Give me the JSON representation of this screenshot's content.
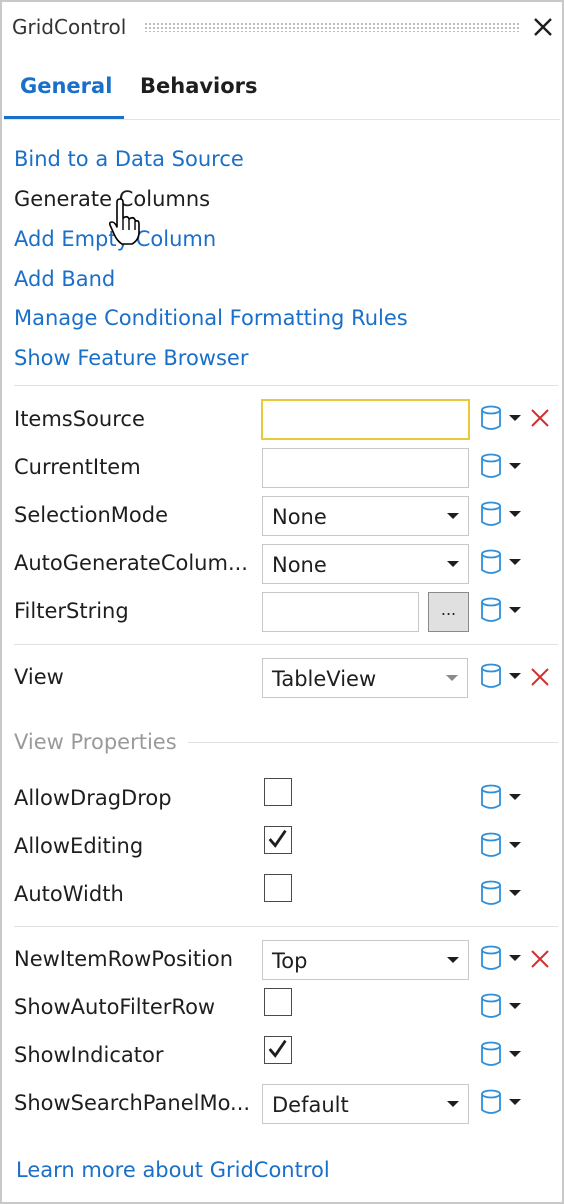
{
  "window": {
    "title": "GridControl",
    "close_icon": "close-icon"
  },
  "tabs": [
    {
      "label": "General",
      "selected": true
    },
    {
      "label": "Behaviors",
      "selected": false
    }
  ],
  "actions": [
    "Bind to a Data Source",
    "Generate Columns",
    "Add Empty Column",
    "Add Band",
    "Manage Conditional Formatting Rules",
    "Show Feature Browser"
  ],
  "properties": {
    "items_source": {
      "label": "ItemsSource",
      "value": ""
    },
    "current_item": {
      "label": "CurrentItem",
      "value": ""
    },
    "selection_mode": {
      "label": "SelectionMode",
      "value": "None"
    },
    "auto_generate_columns": {
      "label": "AutoGenerateColum...",
      "value": "None"
    },
    "filter_string": {
      "label": "FilterString",
      "value": "",
      "button": "..."
    },
    "view": {
      "label": "View",
      "value": "TableView"
    }
  },
  "view_properties": {
    "heading": "View Properties",
    "allow_drag_drop": {
      "label": "AllowDragDrop",
      "checked": false
    },
    "allow_editing": {
      "label": "AllowEditing",
      "checked": true
    },
    "auto_width": {
      "label": "AutoWidth",
      "checked": false
    }
  },
  "table_view": {
    "new_item_row_position": {
      "label": "NewItemRowPosition",
      "value": "Top"
    },
    "show_auto_filter_row": {
      "label": "ShowAutoFilterRow",
      "checked": false
    },
    "show_indicator": {
      "label": "ShowIndicator",
      "checked": true
    },
    "show_search_panel_mode": {
      "label": "ShowSearchPanelMo...",
      "value": "Default"
    }
  },
  "footer": {
    "link": "Learn more about GridControl"
  },
  "colors": {
    "accent": "#1a6fc9",
    "reset": "#d32f2f",
    "db_icon": "#2f8fd8",
    "focus": "#e8c93a"
  }
}
